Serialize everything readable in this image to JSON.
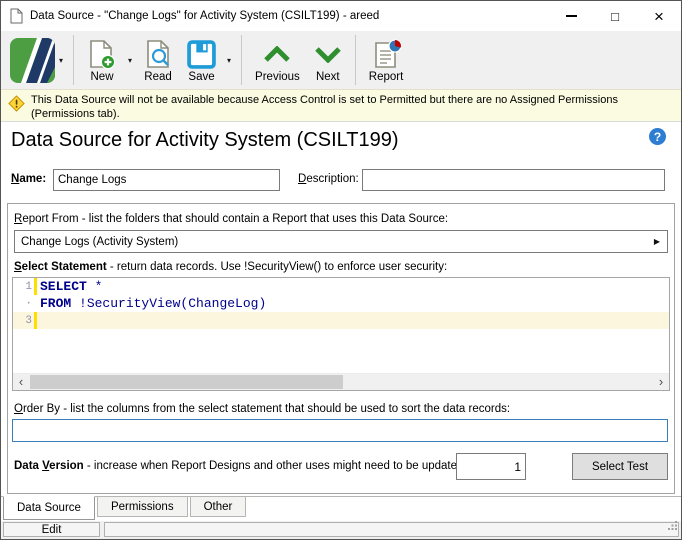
{
  "titlebar": {
    "title": "Data Source - \"Change Logs\" for Activity System (CSILT199) - areed",
    "maximize_glyph": "□",
    "close_glyph": "×"
  },
  "toolbar": {
    "new_label": "New",
    "read_label": "Read",
    "save_label": "Save",
    "previous_label": "Previous",
    "next_label": "Next",
    "report_label": "Report",
    "dropdown_glyph": "▾"
  },
  "warning": {
    "text": "This Data Source will not be available because Access Control is set to Permitted but there are no Assigned Permissions (Permissions tab)."
  },
  "header": {
    "title": "Data Source for Activity System (CSILT199)",
    "help_glyph": "?"
  },
  "form": {
    "name": {
      "label_initial": "N",
      "label_rest": "ame:",
      "value": "Change Logs"
    },
    "description": {
      "label_initial": "D",
      "label_rest": "escription:",
      "value": ""
    },
    "report_from": {
      "label_initial": "R",
      "label_rest": "eport From",
      "label_desc": " - list the folders that should contain a Report that uses this Data Source:",
      "value": "Change Logs (Activity System)",
      "arrow_glyph": "▶"
    },
    "select_statement": {
      "label_initial": "S",
      "label_rest": "elect Statement",
      "label_desc": " - return data records. Use !SecurityView() to enforce user security:"
    },
    "order_by": {
      "label_initial": "O",
      "label_rest": "rder By",
      "label_desc": " - list the columns from the select statement that should be used to sort the data records:",
      "value": ""
    },
    "data_version": {
      "label_pre": "Data ",
      "label_initial": "V",
      "label_rest": "ersion",
      "label_desc": " - increase when Report Designs and other uses might need to be updated:",
      "value": "1"
    },
    "select_test_label": "Select Test"
  },
  "sql_editor": {
    "lines": [
      {
        "num": "1",
        "keyword": "SELECT",
        "code": " *"
      },
      {
        "num": "·",
        "keyword": "FROM",
        "code": " !SecurityView(ChangeLog)"
      },
      {
        "num": "3",
        "keyword": "",
        "code": ""
      }
    ],
    "scroll_left_glyph": "‹",
    "scroll_right_glyph": "›"
  },
  "tabs": [
    {
      "label": "Data Source"
    },
    {
      "label": "Permissions"
    },
    {
      "label": "Other"
    }
  ],
  "statusbar": {
    "mode": "Edit"
  },
  "icons": {
    "app_logo": "a-logo",
    "new": "page-plus",
    "read": "page-magnifier",
    "save": "floppy-disk",
    "previous": "chevron-up",
    "next": "chevron-down",
    "report": "page-pie-chart",
    "warning": "warning-diamond",
    "help": "question-circle"
  },
  "colors": {
    "keyword_blue": "#00008b",
    "current_line_bg": "#fdf6df",
    "marker_yellow": "#ffdf00",
    "warning_bg": "#fbfbe1",
    "save_blue": "#1e9cd7",
    "toolbar_green": "#2f8f2f",
    "logo_green": "#4d9e43",
    "logo_navy": "#1f3a66",
    "focus_border": "#3d7ebd",
    "help_blue": "#2d7dd2"
  }
}
